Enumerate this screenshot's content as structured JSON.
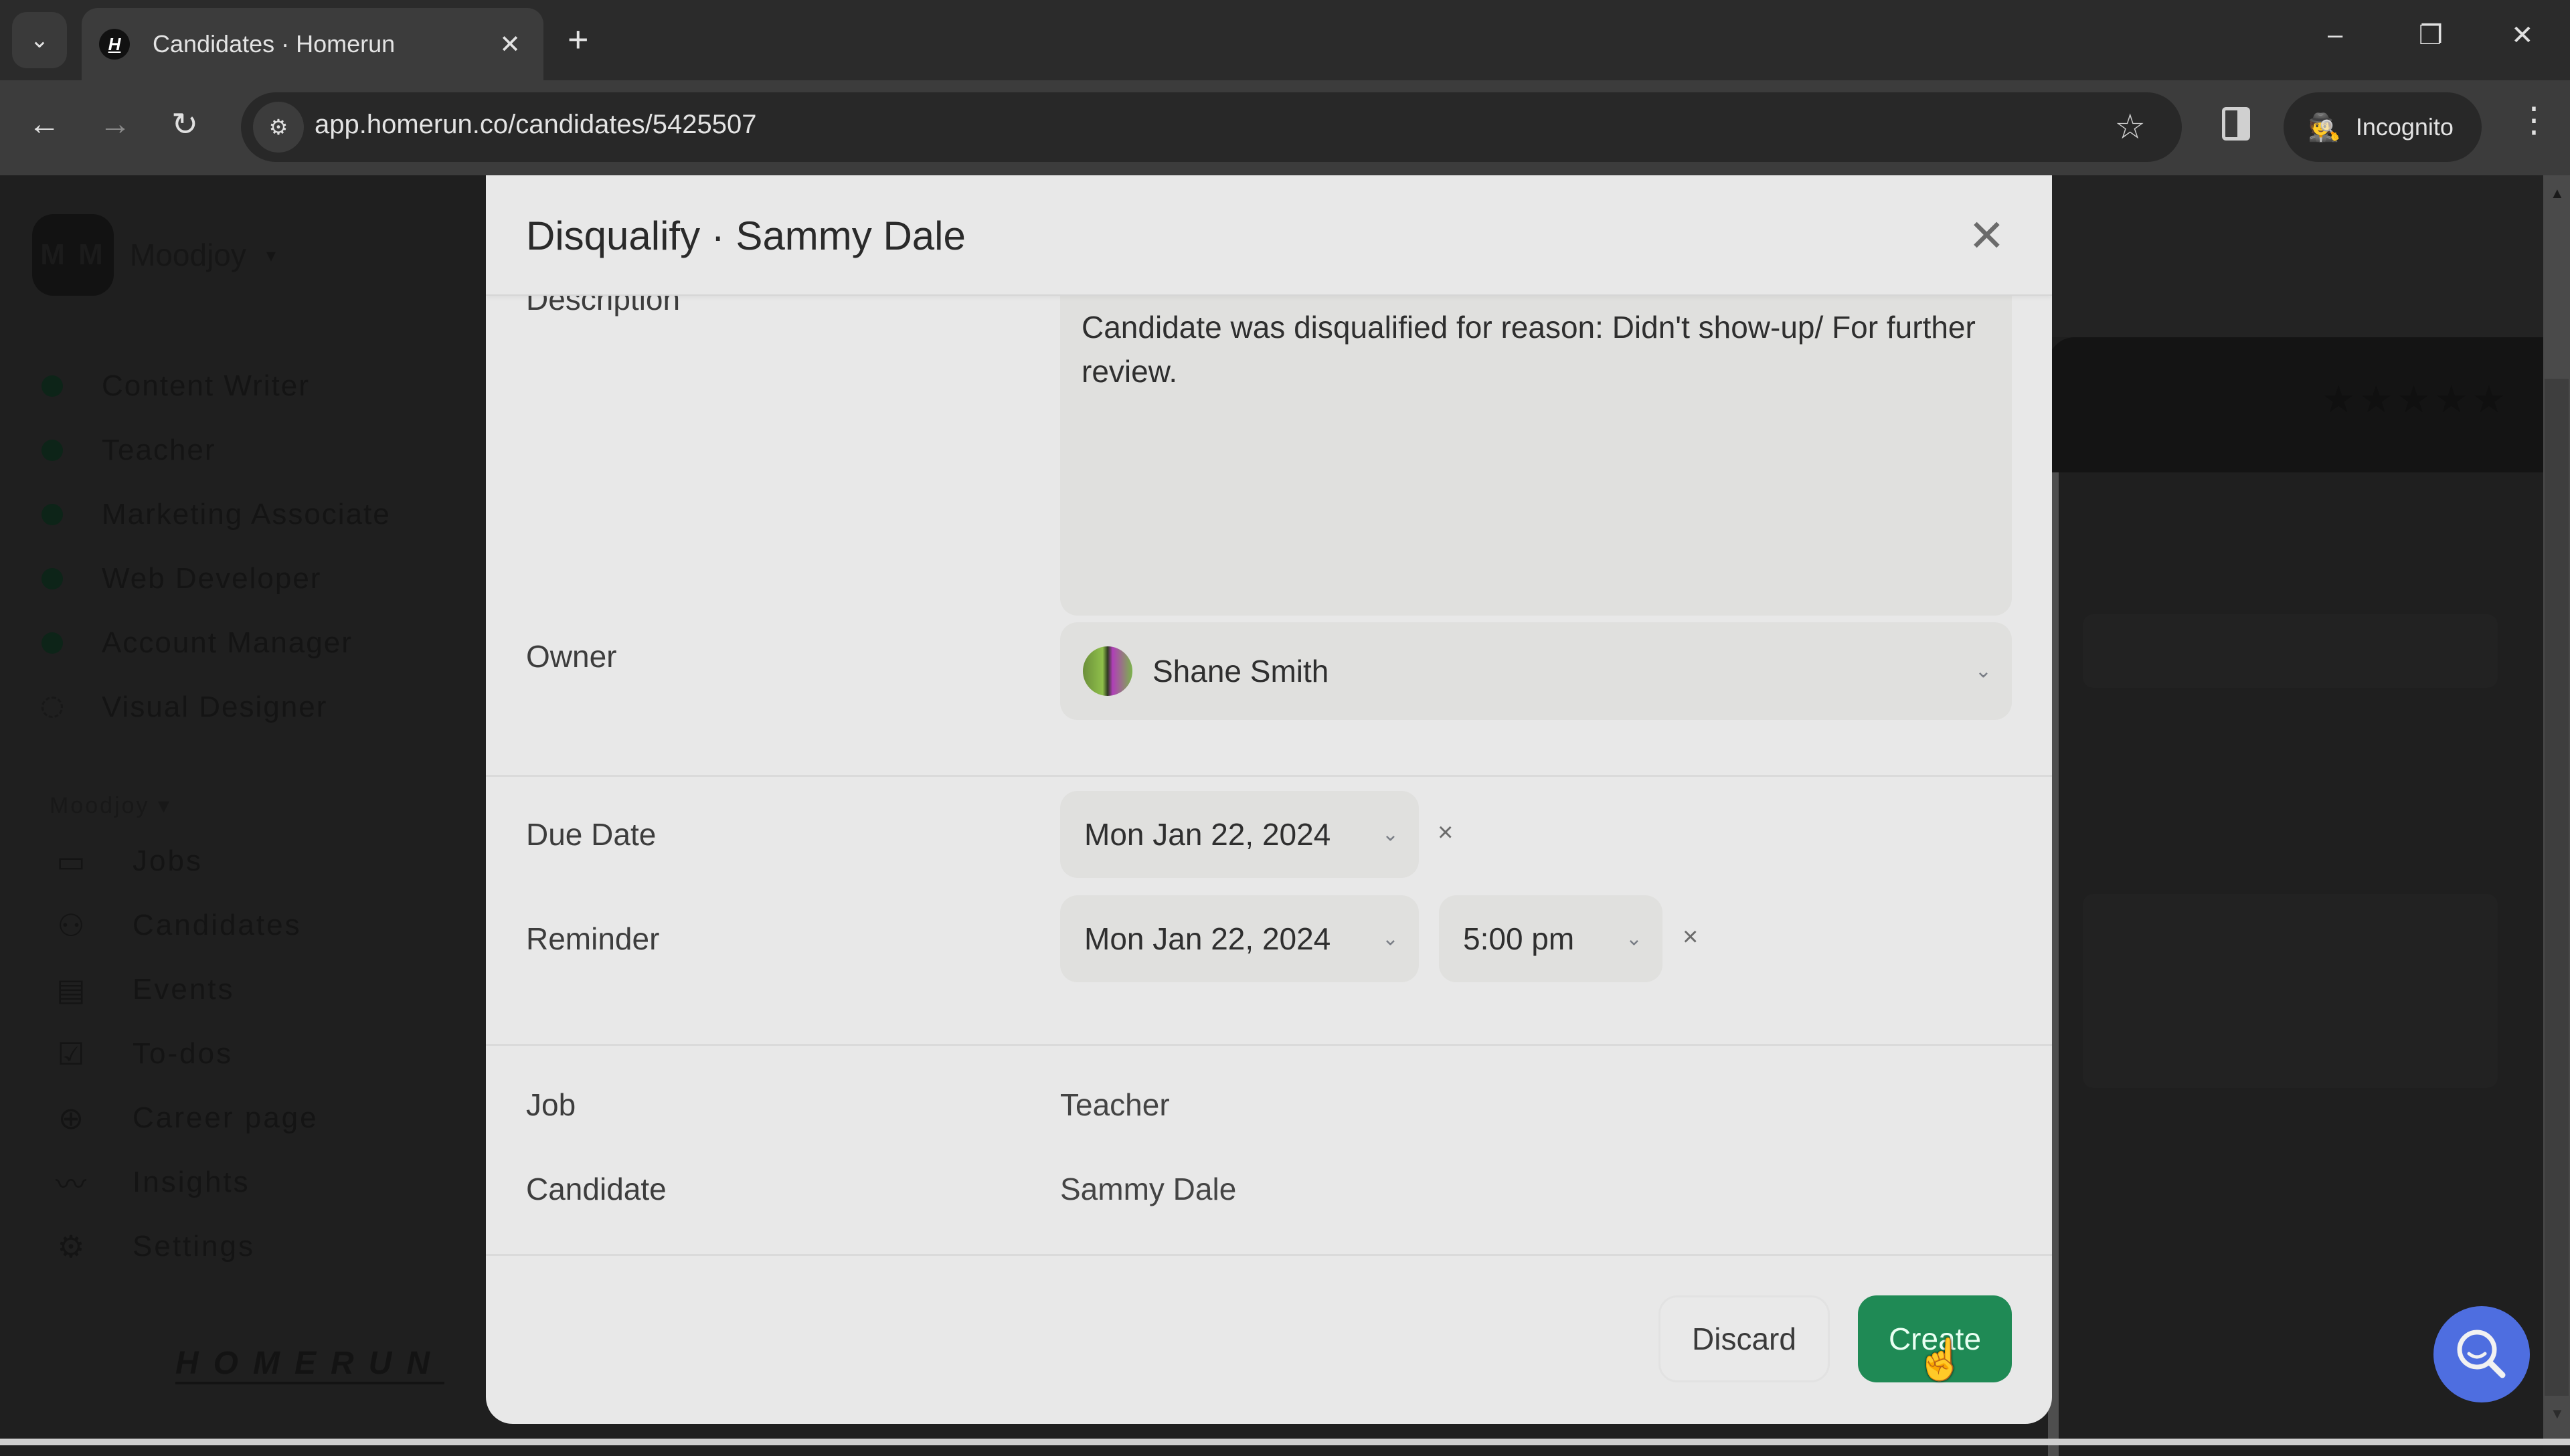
{
  "browser": {
    "tab_title": "Candidates · Homerun",
    "favicon_letter": "H",
    "url": "app.homerun.co/candidates/5425507",
    "incognito_label": "Incognito",
    "icons": {
      "tab_search": "⌄",
      "tab_close": "✕",
      "new_tab": "+",
      "minimize": "–",
      "restore": "❐",
      "close": "✕",
      "back": "←",
      "forward": "→",
      "reload": "↻",
      "site_info": "⚙",
      "bookmark": "☆",
      "incognito": "🕵",
      "menu": "⋮"
    }
  },
  "sidebar": {
    "org_initials": "M M",
    "org_name": "Moodjoy",
    "org_caret": "▾",
    "jobs": [
      {
        "label": "Content Writer",
        "status": "active"
      },
      {
        "label": "Teacher",
        "status": "active"
      },
      {
        "label": "Marketing Associate",
        "status": "active"
      },
      {
        "label": "Web Developer",
        "status": "active"
      },
      {
        "label": "Account Manager",
        "status": "active"
      },
      {
        "label": "Visual Designer",
        "status": "draft"
      }
    ],
    "section_label": "Moodjoy ▾",
    "nav": [
      {
        "label": "Jobs",
        "icon": "▭"
      },
      {
        "label": "Candidates",
        "icon": "⚇"
      },
      {
        "label": "Events",
        "icon": "▤"
      },
      {
        "label": "To-dos",
        "icon": "☑"
      },
      {
        "label": "Career page",
        "icon": "⊕"
      },
      {
        "label": "Insights",
        "icon": "〰"
      },
      {
        "label": "Settings",
        "icon": "⚙"
      }
    ],
    "brand": "HOMERUN"
  },
  "background": {
    "rating_stars": "★★★★★"
  },
  "modal": {
    "title": "Disqualify · Sammy Dale",
    "close_icon": "✕",
    "description_label": "Description",
    "description_value": "Candidate was disqualified for reason: Didn't show-up/ For further review.",
    "owner_label": "Owner",
    "owner_value": "Shane Smith",
    "due_date_label": "Due Date",
    "due_date_value": "Mon Jan 22, 2024",
    "reminder_label": "Reminder",
    "reminder_date_value": "Mon Jan 22, 2024",
    "reminder_time_value": "5:00 pm",
    "job_label": "Job",
    "job_value": "Teacher",
    "candidate_label": "Candidate",
    "candidate_value": "Sammy Dale",
    "chevron": "⌄",
    "clear_icon": "×",
    "discard_label": "Discard",
    "create_label": "Create"
  },
  "colors": {
    "create_button": "#1f8a55",
    "search_fab": "#4e6ee0",
    "job_active_dot": "#0d2418"
  }
}
